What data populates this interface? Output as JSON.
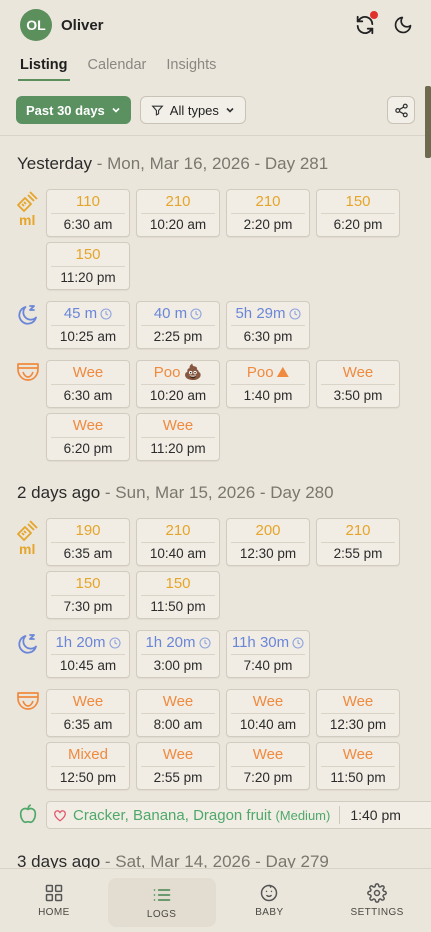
{
  "header": {
    "avatar_initials": "OL",
    "user_name": "Oliver",
    "sync_icon": "sync-icon",
    "theme_icon": "moon-icon"
  },
  "tabs": [
    {
      "label": "Listing",
      "active": true
    },
    {
      "label": "Calendar",
      "active": false
    },
    {
      "label": "Insights",
      "active": false
    }
  ],
  "filters": {
    "range_label": "Past 30 days",
    "type_label": "All types",
    "share_icon": "share-icon"
  },
  "colors": {
    "accent": "#5b9160",
    "bottle": "#e5a52a",
    "sleep": "#6a86d8",
    "diaper": "#ef8a3f",
    "food": "#4fa86a",
    "badge": "#e0312c"
  },
  "days": [
    {
      "title": "Yesterday",
      "subtitle": " - Mon, Mar 16, 2026 - Day 281",
      "ml_label": "ml",
      "bottle": [
        {
          "v": "110",
          "t": "6:30 am"
        },
        {
          "v": "210",
          "t": "10:20 am"
        },
        {
          "v": "210",
          "t": "2:20 pm"
        },
        {
          "v": "150",
          "t": "6:20 pm"
        },
        {
          "v": "150",
          "t": "11:20 pm"
        }
      ],
      "sleep": [
        {
          "v": "45 m",
          "t": "10:25 am"
        },
        {
          "v": "40 m",
          "t": "2:25 pm"
        },
        {
          "v": "5h 29m",
          "t": "6:30 pm"
        }
      ],
      "diaper": [
        {
          "v": "Wee",
          "t": "6:30 am"
        },
        {
          "v": "Poo",
          "emoji": "💩",
          "t": "10:20 am"
        },
        {
          "v": "Poo",
          "emoji": "⛰",
          "t": "1:40 pm"
        },
        {
          "v": "Wee",
          "t": "3:50 pm"
        },
        {
          "v": "Wee",
          "t": "6:20 pm"
        },
        {
          "v": "Wee",
          "t": "11:20 pm"
        }
      ]
    },
    {
      "title": "2 days ago",
      "subtitle": " - Sun, Mar 15, 2026 - Day 280",
      "ml_label": "ml",
      "bottle": [
        {
          "v": "190",
          "t": "6:35 am"
        },
        {
          "v": "210",
          "t": "10:40 am"
        },
        {
          "v": "200",
          "t": "12:30 pm"
        },
        {
          "v": "210",
          "t": "2:55 pm"
        },
        {
          "v": "150",
          "t": "7:30 pm"
        },
        {
          "v": "150",
          "t": "11:50 pm"
        }
      ],
      "sleep": [
        {
          "v": "1h 20m",
          "t": "10:45 am"
        },
        {
          "v": "1h 20m",
          "t": "3:00 pm"
        },
        {
          "v": "11h 30m",
          "t": "7:40 pm"
        }
      ],
      "diaper": [
        {
          "v": "Wee",
          "t": "6:35 am"
        },
        {
          "v": "Wee",
          "t": "8:00 am"
        },
        {
          "v": "Wee",
          "t": "10:40 am"
        },
        {
          "v": "Wee",
          "t": "12:30 pm"
        },
        {
          "v": "Mixed",
          "t": "12:50 pm"
        },
        {
          "v": "Wee",
          "t": "2:55 pm"
        },
        {
          "v": "Wee",
          "t": "7:20 pm"
        },
        {
          "v": "Wee",
          "t": "11:50 pm"
        }
      ],
      "food": {
        "items": "Cracker, Banana, Dragon fruit",
        "qty": "(Medium)",
        "time": "1:40 pm"
      }
    },
    {
      "title": "3 days ago",
      "subtitle": " - Sat, Mar 14, 2026 - Day 279"
    }
  ],
  "bottom_nav": [
    {
      "label": "HOME",
      "icon": "grid-icon",
      "active": false
    },
    {
      "label": "LOGS",
      "icon": "list-icon",
      "active": true
    },
    {
      "label": "BABY",
      "icon": "baby-icon",
      "active": false
    },
    {
      "label": "SETTINGS",
      "icon": "gear-icon",
      "active": false
    }
  ]
}
